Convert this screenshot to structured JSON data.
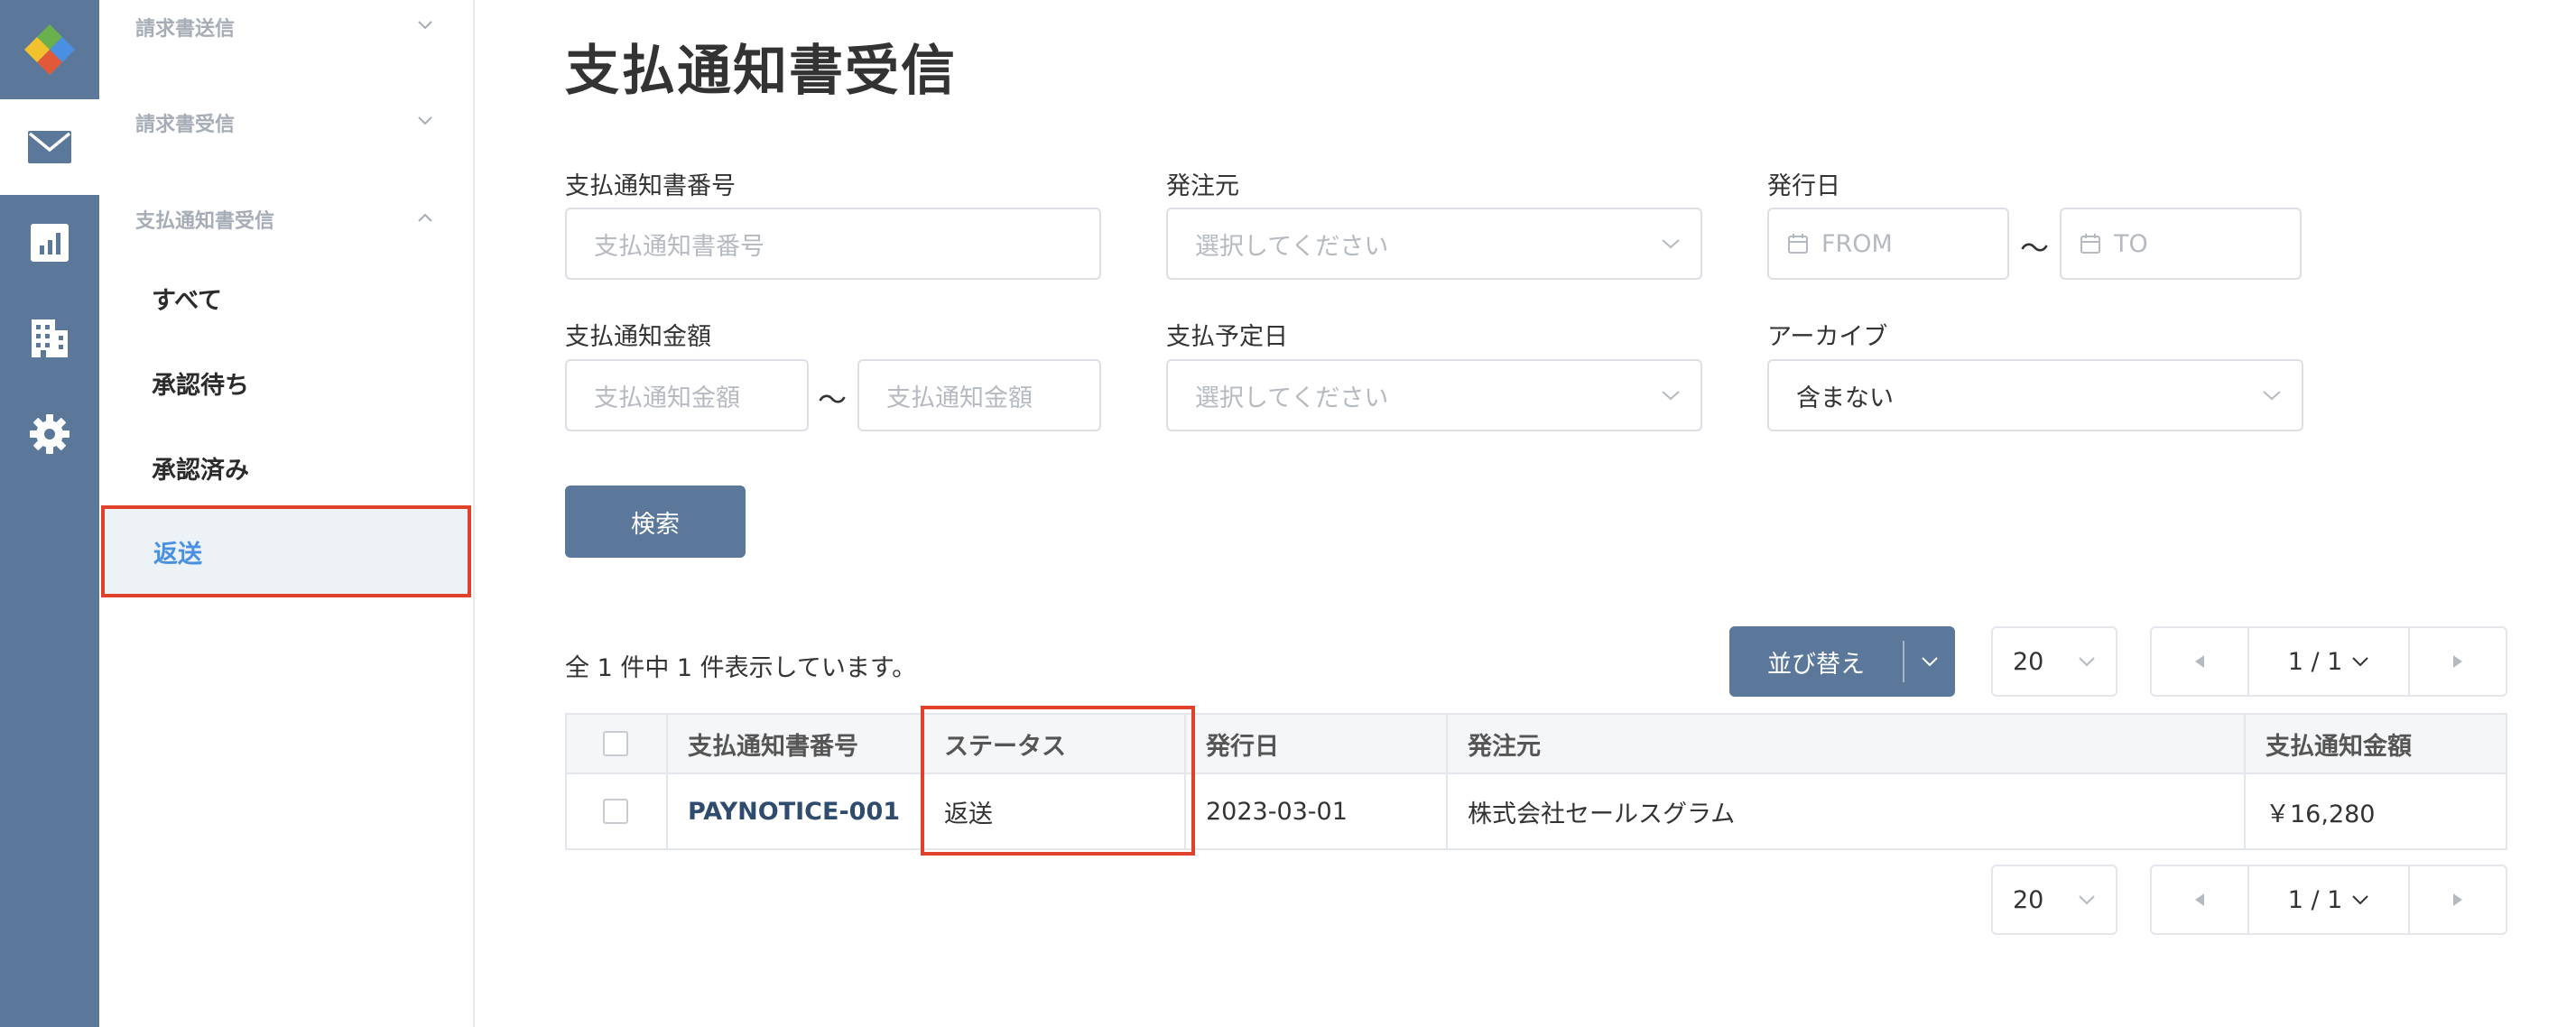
{
  "sidebar": {
    "groups": [
      {
        "label": "請求書送信"
      },
      {
        "label": "請求書受信"
      },
      {
        "label": "支払通知書受信"
      }
    ],
    "sub_items": [
      {
        "label": "すべて"
      },
      {
        "label": "承認待ち"
      },
      {
        "label": "承認済み"
      },
      {
        "label": "返送"
      }
    ],
    "active_sub_item": "返送"
  },
  "page": {
    "title": "支払通知書受信"
  },
  "filters": {
    "notice_number": {
      "label": "支払通知書番号",
      "placeholder": "支払通知書番号"
    },
    "issuer": {
      "label": "発注元",
      "placeholder": "選択してください"
    },
    "issue_date": {
      "label": "発行日",
      "from_placeholder": "FROM",
      "to_placeholder": "TO",
      "separator": "〜"
    },
    "amount": {
      "label": "支払通知金額",
      "min_placeholder": "支払通知金額",
      "max_placeholder": "支払通知金額",
      "separator": "〜"
    },
    "payment_date": {
      "label": "支払予定日",
      "placeholder": "選択してください"
    },
    "archive": {
      "label": "アーカイブ",
      "value": "含まない"
    }
  },
  "search_button": "検索",
  "results": {
    "count_text": "全 1 件中 1 件表示しています。",
    "sort_label": "並び替え",
    "per_page": "20",
    "page_indicator": "1 / 1"
  },
  "table": {
    "headers": [
      "支払通知書番号",
      "ステータス",
      "発行日",
      "発注元",
      "支払通知金額"
    ],
    "rows": [
      {
        "number": "PAYNOTICE-001",
        "status": "返送",
        "issue_date": "2023-03-01",
        "issuer": "株式会社セールスグラム",
        "amount": "￥16,280"
      }
    ]
  },
  "colors": {
    "rail": "#5b789a",
    "primary_button": "#5b789a",
    "active_link": "#4a90e2",
    "highlight_border": "#e0412b"
  },
  "icons": {
    "rail": [
      "logo-icon",
      "mail-icon",
      "chart-icon",
      "building-icon",
      "gear-icon"
    ]
  }
}
